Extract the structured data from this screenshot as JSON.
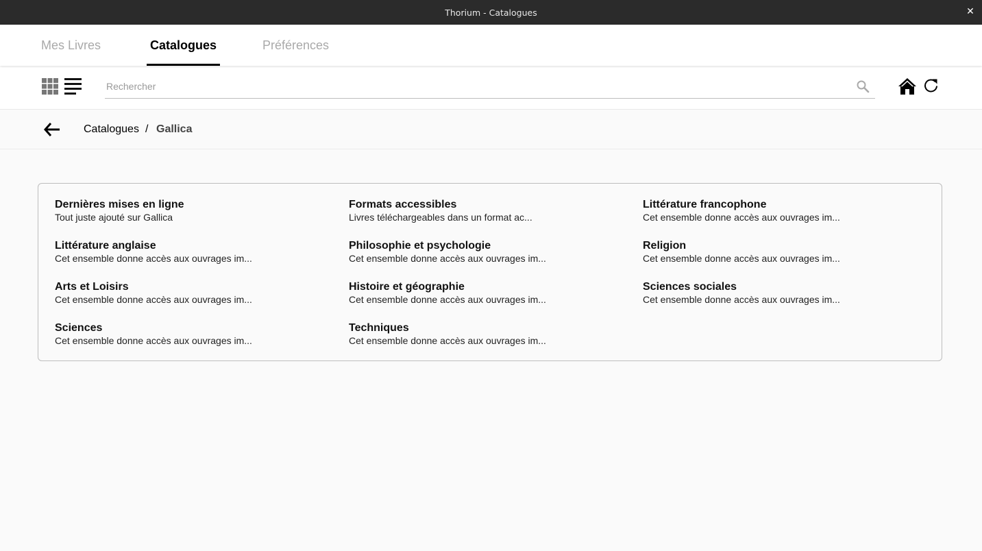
{
  "window": {
    "title": "Thorium - Catalogues",
    "close_glyph": "✕"
  },
  "nav": {
    "tabs": [
      {
        "label": "Mes Livres",
        "active": false
      },
      {
        "label": "Catalogues",
        "active": true
      },
      {
        "label": "Préférences",
        "active": false
      }
    ]
  },
  "toolbar": {
    "grid_view_icon": "grid-view-icon",
    "list_view_icon": "list-view-icon",
    "search_placeholder": "Rechercher",
    "search_value": "",
    "search_icon": "search-icon",
    "home_icon": "home-icon",
    "refresh_icon": "refresh-icon"
  },
  "breadcrumb": {
    "back_icon": "arrow-left-icon",
    "parent": "Catalogues",
    "separator": "/",
    "current": "Gallica"
  },
  "catalog": {
    "entries": [
      {
        "title": "Dernières mises en ligne",
        "description": "Tout juste ajouté sur Gallica"
      },
      {
        "title": "Formats accessibles",
        "description": "Livres téléchargeables dans un format ac..."
      },
      {
        "title": "Littérature francophone",
        "description": "Cet ensemble donne accès aux ouvrages im..."
      },
      {
        "title": "Littérature anglaise",
        "description": "Cet ensemble donne accès aux ouvrages im..."
      },
      {
        "title": "Philosophie et psychologie",
        "description": "Cet ensemble donne accès aux ouvrages im..."
      },
      {
        "title": "Religion",
        "description": "Cet ensemble donne accès aux ouvrages im..."
      },
      {
        "title": "Arts et Loisirs",
        "description": "Cet ensemble donne accès aux ouvrages im..."
      },
      {
        "title": "Histoire et géographie",
        "description": "Cet ensemble donne accès aux ouvrages im..."
      },
      {
        "title": "Sciences sociales",
        "description": "Cet ensemble donne accès aux ouvrages im..."
      },
      {
        "title": "Sciences",
        "description": "Cet ensemble donne accès aux ouvrages im..."
      },
      {
        "title": "Techniques",
        "description": "Cet ensemble donne accès aux ouvrages im..."
      }
    ]
  },
  "colors": {
    "titlebar_bg": "#2b2b2b",
    "active_tab": "#000000",
    "inactive_tab": "#a9a9a9",
    "page_bg": "#fafafa"
  }
}
